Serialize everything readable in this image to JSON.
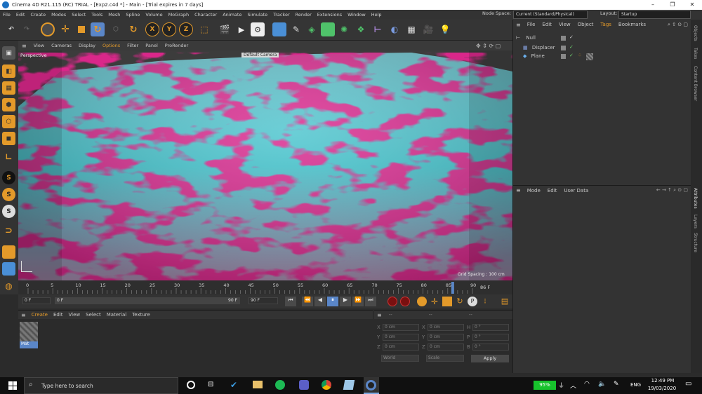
{
  "window": {
    "title": "Cinema 4D R21.115 (RC) TRIAL - [Exp2.c4d *] - Main - [Trial expires in 7 days]"
  },
  "menu": [
    "File",
    "Edit",
    "Create",
    "Modes",
    "Select",
    "Tools",
    "Mesh",
    "Spline",
    "Volume",
    "MoGraph",
    "Character",
    "Animate",
    "Simulate",
    "Tracker",
    "Render",
    "Extensions",
    "Window",
    "Help"
  ],
  "node_space": {
    "label": "Node Space:",
    "value": "Current (Standard/Physical)"
  },
  "layout": {
    "label": "Layout:",
    "value": "Startup"
  },
  "toolbar": {
    "axis_x": "X",
    "axis_y": "Y",
    "axis_z": "Z"
  },
  "viewport": {
    "menu": [
      "View",
      "Cameras",
      "Display",
      "Options",
      "Filter",
      "Panel",
      "ProRender"
    ],
    "name": "Perspective",
    "camera": "Default Camera",
    "grid_spacing": "Grid Spacing : 100 cm"
  },
  "timeline": {
    "ticks": [
      "0",
      "5",
      "10",
      "15",
      "20",
      "25",
      "30",
      "35",
      "40",
      "45",
      "50",
      "55",
      "60",
      "65",
      "70",
      "75",
      "80",
      "85",
      "90"
    ],
    "current": "86 F",
    "current_frame": 86,
    "start_field": "0 F",
    "min_field": "0 F",
    "max_field": "90 F",
    "end_field": "90 F"
  },
  "material_manager": {
    "menu": [
      "Create",
      "Edit",
      "View",
      "Select",
      "Material",
      "Texture"
    ],
    "materials": [
      {
        "name": "Mat"
      }
    ]
  },
  "coordinates": {
    "header": [
      "--",
      "--",
      "--"
    ],
    "rows": [
      {
        "axis": "X",
        "pos": "0 cm",
        "size_axis": "X",
        "size": "0 cm",
        "rot_axis": "H",
        "rot": "0 °"
      },
      {
        "axis": "Y",
        "pos": "0 cm",
        "size_axis": "Y",
        "size": "0 cm",
        "rot_axis": "P",
        "rot": "0 °"
      },
      {
        "axis": "Z",
        "pos": "0 cm",
        "size_axis": "Z",
        "size": "0 cm",
        "rot_axis": "B",
        "rot": "0 °"
      }
    ],
    "mode_a": "World",
    "mode_b": "Scale",
    "apply": "Apply"
  },
  "object_manager": {
    "menu": [
      "File",
      "Edit",
      "View",
      "Object",
      "Tags",
      "Bookmarks"
    ],
    "objects": [
      {
        "name": "Null"
      },
      {
        "name": "Displacer"
      },
      {
        "name": "Plane"
      }
    ]
  },
  "attribute_manager": {
    "menu": [
      "Mode",
      "Edit",
      "User Data"
    ]
  },
  "side_tabs_top": [
    "Objects",
    "Takes",
    "Content Browser"
  ],
  "side_tabs_bottom": [
    "Attributes",
    "Layers",
    "Structure"
  ],
  "taskbar": {
    "search_placeholder": "Type here to search",
    "battery": "95%",
    "language": "ENG",
    "time": "12:49 PM",
    "date": "19/03/2020"
  },
  "colors": {
    "accent": "#5a86c8",
    "pink": "#e3268f",
    "cyan": "#35c9cf",
    "orange": "#e39a2a"
  }
}
